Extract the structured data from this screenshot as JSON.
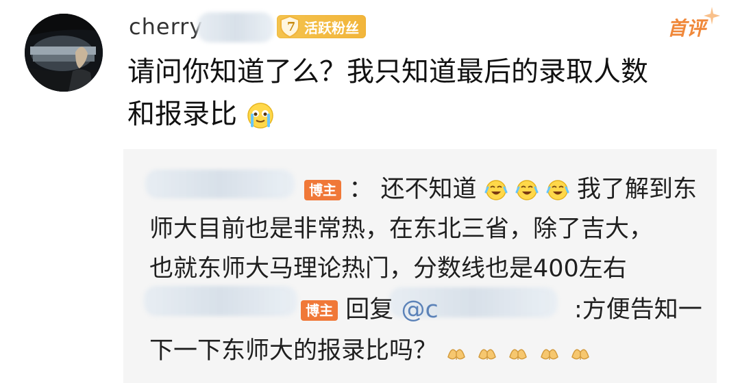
{
  "comment": {
    "username": "cherry",
    "level": {
      "number": "7",
      "label": "活跃粉丝"
    },
    "first_label": "首评",
    "text_line1": "请问你知道了么？我只知道最后的录取人数",
    "text_line2": "和报录比",
    "emoji": "crying-face-emoji"
  },
  "replies": [
    {
      "author_tag": "博主",
      "separator": "：",
      "text_start": "还不知道",
      "emoji_repeat": "laughing-crying-emoji",
      "text_end": "我了解到东",
      "text_line2": "师大目前也是非常热，在东北三省，除了吉大，",
      "text_line3": "也就东师大马理论热门，分数线也是400左右"
    },
    {
      "author_tag": "博主",
      "prefix": "回复",
      "mention": "@c",
      "mention_tail": ":方便告知一",
      "text_line2": "下一下东师大的报录比吗？",
      "emoji_repeat": "praying-hands-emoji"
    }
  ],
  "colors": {
    "accent": "#f07838",
    "level_badge": "#f2b53b",
    "first_comment": "#f0883a",
    "mention": "#5b82b8",
    "reply_background": "#f5f5f5"
  }
}
